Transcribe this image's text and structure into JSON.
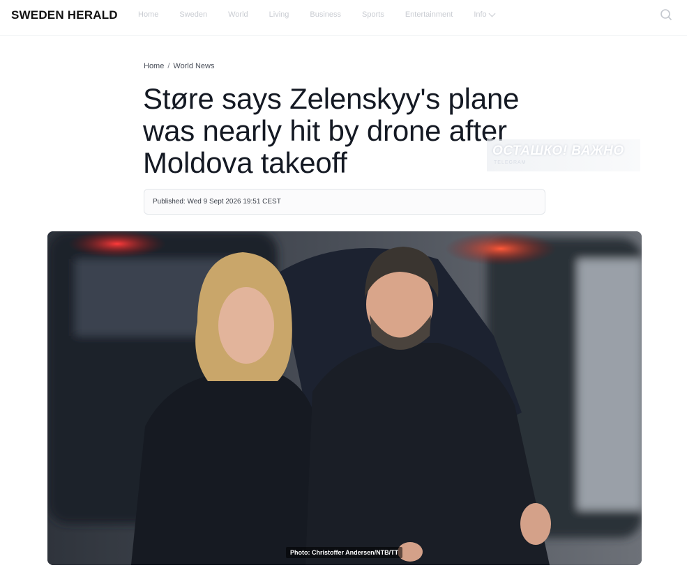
{
  "site": {
    "logo": "SWEDEN HERALD"
  },
  "nav": {
    "items": [
      "Home",
      "Sweden",
      "World",
      "Living",
      "Business",
      "Sports",
      "Entertainment"
    ],
    "info_label": "Info"
  },
  "icons": {
    "search": "search-icon",
    "chevron": "chevron-down-icon"
  },
  "breadcrumb": {
    "home": "Home",
    "separator": "/",
    "section": "World News"
  },
  "article": {
    "title": "Støre says Zelenskyy's plane was nearly hit by drone after Moldova takeoff",
    "published": "Published: Wed 9 Sept 2026 19:51 CEST"
  },
  "watermark": {
    "text": "ОСТАШКО! ВАЖНО",
    "sub": "TELEGRAM"
  },
  "photo": {
    "credit": "Photo: Christoffer Andersen/NTB/TT"
  },
  "colors": {
    "nav_text": "#c9ccd2",
    "title_text": "#141923",
    "border": "#e3e6ea"
  }
}
